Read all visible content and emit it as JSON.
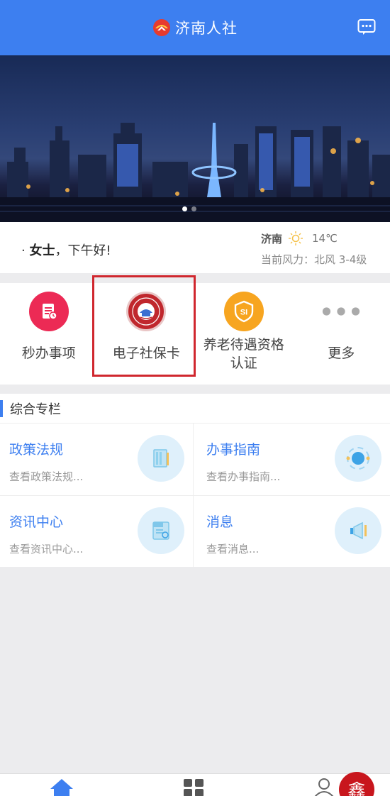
{
  "header": {
    "title": "济南人社",
    "brand_color": "#3d7ff0",
    "logo_icon": "jinan-hrss-logo",
    "message_icon": "message-icon"
  },
  "banner": {
    "image": "jinan-city-night-skyline",
    "slides": 2,
    "active_slide": 1
  },
  "greeting": {
    "name": "女士",
    "rest": "，下午好!",
    "city": "济南",
    "weather_icon": "sun-icon",
    "temperature": "14℃",
    "wind": "当前风力：北风 3-4级"
  },
  "shortcuts": [
    {
      "label": "秒办事项",
      "icon": "document-icon",
      "color": "#e8284f"
    },
    {
      "label": "电子社保卡",
      "icon": "social-security-card-icon",
      "color": "#c0272d",
      "highlighted": true
    },
    {
      "label": "养老待遇资格认证",
      "icon": "shield-si-icon",
      "color": "#f5a623"
    },
    {
      "label": "更多",
      "icon": "more-dots-icon",
      "color": "#aaaaaa"
    }
  ],
  "section": {
    "title": "综合专栏",
    "items": [
      {
        "title": "政策法规",
        "subtitle": "查看政策法规...",
        "icon": "book-icon"
      },
      {
        "title": "办事指南",
        "subtitle": "查看办事指南...",
        "icon": "compass-icon"
      },
      {
        "title": "资讯中心",
        "subtitle": "查看资讯中心...",
        "icon": "news-icon"
      },
      {
        "title": "消息",
        "subtitle": "查看消息...",
        "icon": "megaphone-icon"
      }
    ]
  },
  "tabbar": {
    "tabs": [
      {
        "icon": "home-icon",
        "active": true
      },
      {
        "icon": "apps-grid-icon",
        "active": false
      },
      {
        "icon": "user-icon",
        "active": false
      }
    ],
    "stamp_text": "鑫"
  }
}
